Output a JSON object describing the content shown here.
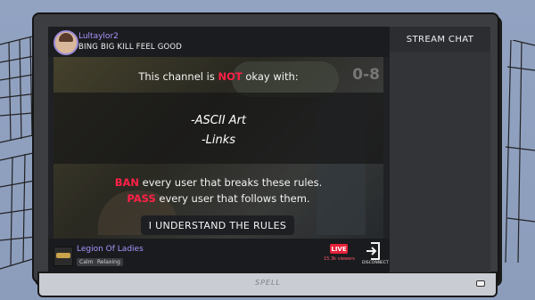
{
  "monitor": {
    "brand": "SPELL"
  },
  "stream": {
    "username": "Lultaylor2",
    "title": "BING BIG KILL FEEL GOOD",
    "game_score": "0-8"
  },
  "rules_overlay": {
    "headline_prefix": "This channel is ",
    "headline_emphasis": "NOT",
    "headline_suffix": " okay with:",
    "rules": [
      "-ASCII Art",
      "-Links"
    ],
    "ban_word": "BAN",
    "ban_text": " every user that breaks these rules.",
    "pass_word": "PASS",
    "pass_text": " every user that follows them.",
    "confirm_button": "I UNDERSTAND THE RULES",
    "accent_color": "#ff2147"
  },
  "bottom_bar": {
    "channel_name": "Legion Of Ladies",
    "tags": [
      "Calm",
      "Relaxing"
    ],
    "live_label": "LIVE",
    "viewers": "15.3k viewers",
    "disconnect_label": "DISCONNECT"
  },
  "chat": {
    "header": "STREAM CHAT"
  },
  "icons": [
    "user-avatar",
    "channel-thumbnail",
    "disconnect-door-icon"
  ]
}
